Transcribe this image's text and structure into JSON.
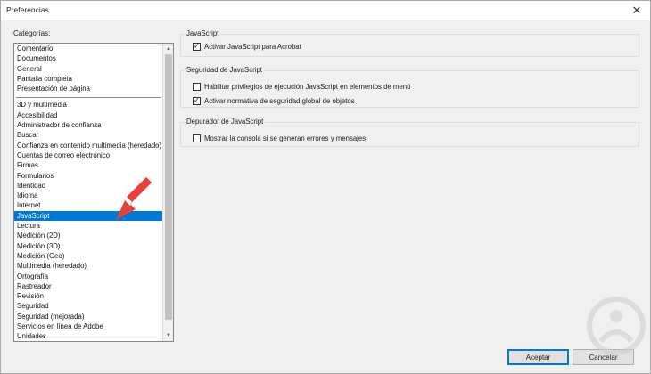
{
  "window": {
    "title": "Preferencias",
    "close_icon": "close-icon"
  },
  "categories": {
    "label": "Categorías:",
    "top_items": [
      "Comentario",
      "Documentos",
      "General",
      "Pantalla completa",
      "Presentación de página"
    ],
    "items": [
      "3D y multimedia",
      "Accesibilidad",
      "Administrador de confianza",
      "Buscar",
      "Confianza en contenido multimedia (heredado)",
      "Cuentas de correo electrónico",
      "Firmas",
      "Formularios",
      "Identidad",
      "Idioma",
      "Internet",
      "JavaScript",
      "Lectura",
      "Medición (2D)",
      "Medición (3D)",
      "Medición (Geo)",
      "Multimedia (heredado)",
      "Ortografía",
      "Rastreador",
      "Revisión",
      "Seguridad",
      "Seguridad (mejorada)",
      "Servicios en línea de Adobe",
      "Unidades"
    ],
    "selected": "JavaScript"
  },
  "groups": [
    {
      "title": "JavaScript",
      "options": [
        {
          "label": "Activar JavaScript para Acrobat",
          "checked": true
        }
      ]
    },
    {
      "title": "Seguridad de JavaScript",
      "options": [
        {
          "label": "Habilitar privilegios de ejecución JavaScript en elementos de menú",
          "checked": false
        },
        {
          "label": "Activar normativa de seguridad global de objetos",
          "checked": true
        }
      ]
    },
    {
      "title": "Depurador de JavaScript",
      "options": [
        {
          "label": "Mostrar la consola si se generan errores y mensajes",
          "checked": false
        }
      ]
    }
  ],
  "buttons": {
    "accept": "Aceptar",
    "cancel": "Cancelar"
  },
  "colors": {
    "selection": "#0078d7",
    "arrow": "#e8413b"
  }
}
